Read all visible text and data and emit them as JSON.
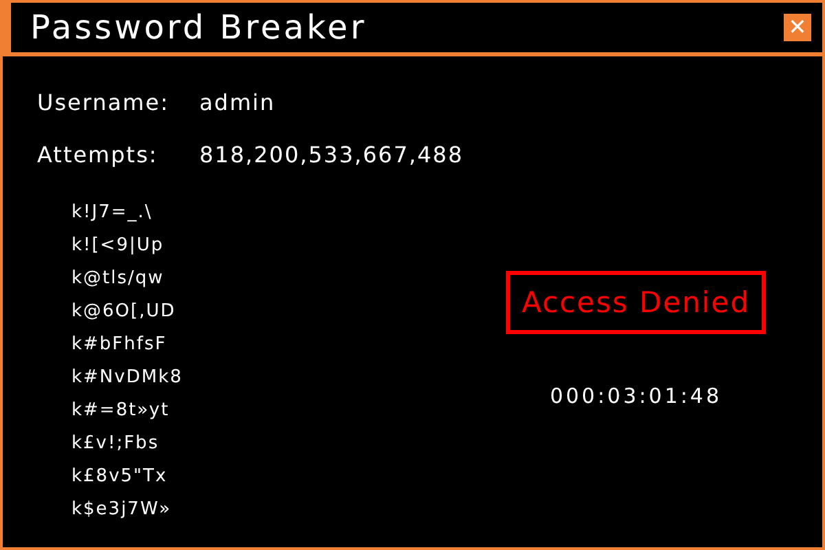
{
  "window": {
    "title": "Password Breaker",
    "close": "✕"
  },
  "fields": [
    {
      "label": "Username:",
      "value": "admin"
    },
    {
      "label": "Attempts:",
      "value": "818,200,533,667,488"
    }
  ],
  "guesses": [
    "k!J7=_.\\",
    "k![<9|Up",
    "k@tls/qw",
    "k@6O[,UD",
    "k#bFhfsF",
    "k#NvDMk8",
    "k#=8t»yt",
    "k£v!;Fbs",
    "k£8v5\"Tx",
    "k$e3j7W»"
  ],
  "status": {
    "message": "Access Denied",
    "granted": false
  },
  "timer": "000:03:01:48"
}
